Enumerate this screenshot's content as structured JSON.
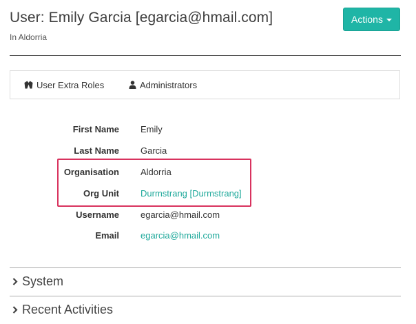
{
  "header": {
    "title": "User: Emily Garcia [egarcia@hmail.com]",
    "subtitle": "In Aldorria",
    "actions_label": "Actions"
  },
  "tabs": [
    {
      "label": "User Extra Roles",
      "icon": "jacket-icon"
    },
    {
      "label": "Administrators",
      "icon": "person-icon"
    }
  ],
  "details": {
    "first_name": {
      "label": "First Name",
      "value": "Emily"
    },
    "last_name": {
      "label": "Last Name",
      "value": "Garcia"
    },
    "organisation": {
      "label": "Organisation",
      "value": "Aldorria"
    },
    "org_unit": {
      "label": "Org Unit",
      "value": "Durmstrang [Durmstrang]"
    },
    "username": {
      "label": "Username",
      "value": "egarcia@hmail.com"
    },
    "email": {
      "label": "Email",
      "value": "egarcia@hmail.com"
    }
  },
  "sections": [
    {
      "label": "System",
      "icon": "chevron-right-icon"
    },
    {
      "label": "Recent Activities",
      "icon": "chevron-right-icon"
    }
  ],
  "colors": {
    "accent": "#1fb5a6",
    "link": "#1fa99b",
    "highlight": "#d8325e"
  }
}
